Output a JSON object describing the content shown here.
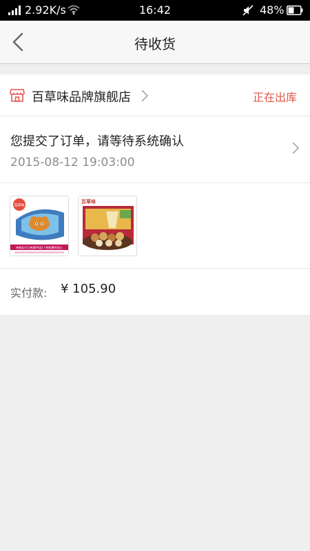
{
  "status_bar": {
    "network_speed": "2.92K/s",
    "time": "16:42",
    "battery": "48%"
  },
  "nav": {
    "title": "待收货"
  },
  "store": {
    "name": "百草味品牌旗舰店",
    "order_status": "正在出库"
  },
  "order_status": {
    "message": "您提交了订单，请等待系统确认",
    "timestamp": "2015-08-12 19:03:00"
  },
  "products": [
    {
      "thumb_logo": "百草味",
      "thumb_banner": "单笔实付订单满99送1个抱枕赠完即止"
    },
    {
      "thumb_logo": "百草味"
    }
  ],
  "payment": {
    "label": "实付款:",
    "amount": "¥ 105.90"
  },
  "colors": {
    "accent": "#e5554b",
    "status_bar": "#000000",
    "nav_background": "#f7f7f7",
    "page_background": "#efefef"
  }
}
